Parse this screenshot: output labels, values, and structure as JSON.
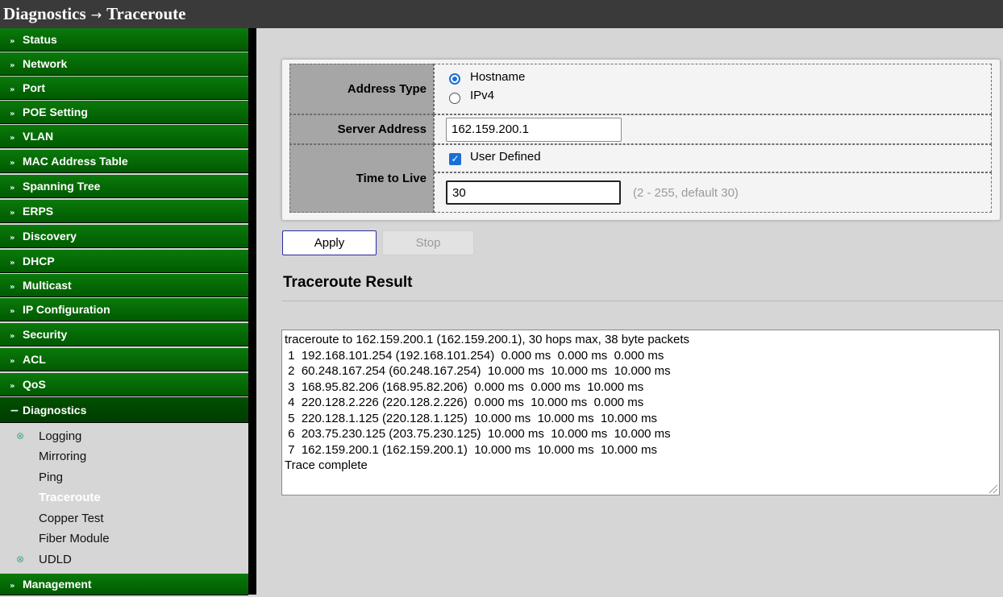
{
  "titlebar": {
    "section": "Diagnostics",
    "separator": "→",
    "page": "Traceroute"
  },
  "menu": [
    {
      "label": "Status",
      "icon": "double-chevron-down-icon"
    },
    {
      "label": "Network",
      "icon": "double-chevron-down-icon"
    },
    {
      "label": "Port",
      "icon": "double-chevron-down-icon"
    },
    {
      "label": "POE Setting",
      "icon": "double-chevron-down-icon"
    },
    {
      "label": "VLAN",
      "icon": "double-chevron-down-icon"
    },
    {
      "label": "MAC Address Table",
      "icon": "double-chevron-down-icon"
    },
    {
      "label": "Spanning Tree",
      "icon": "double-chevron-down-icon"
    },
    {
      "label": "ERPS",
      "icon": "double-chevron-down-icon"
    },
    {
      "label": "Discovery",
      "icon": "double-chevron-down-icon"
    },
    {
      "label": "DHCP",
      "icon": "double-chevron-down-icon"
    },
    {
      "label": "Multicast",
      "icon": "double-chevron-down-icon"
    },
    {
      "label": "IP Configuration",
      "icon": "double-chevron-down-icon"
    },
    {
      "label": "Security",
      "icon": "double-chevron-down-icon"
    },
    {
      "label": "ACL",
      "icon": "double-chevron-down-icon"
    },
    {
      "label": "QoS",
      "icon": "double-chevron-down-icon"
    },
    {
      "label": "Diagnostics",
      "icon": "minus-icon"
    },
    {
      "label": "Management",
      "icon": "double-chevron-down-icon"
    }
  ],
  "submenu": [
    {
      "label": "Logging",
      "icon": "expand-icon"
    },
    {
      "label": "Mirroring"
    },
    {
      "label": "Ping"
    },
    {
      "label": "Traceroute",
      "active": true
    },
    {
      "label": "Copper Test"
    },
    {
      "label": "Fiber Module"
    },
    {
      "label": "UDLD",
      "icon": "expand-icon"
    }
  ],
  "form": {
    "address_type": {
      "label": "Address Type",
      "options": [
        "Hostname",
        "IPv4"
      ],
      "selected": "Hostname"
    },
    "server_address": {
      "label": "Server Address",
      "value": "162.159.200.1"
    },
    "time_to_live": {
      "label": "Time to Live",
      "user_defined_label": "User Defined",
      "user_defined_checked": true,
      "value": "30",
      "hint": "(2 - 255, default 30)"
    }
  },
  "buttons": {
    "apply": "Apply",
    "stop": "Stop"
  },
  "result": {
    "title": "Traceroute Result",
    "lines": [
      "traceroute to 162.159.200.1 (162.159.200.1), 30 hops max, 38 byte packets",
      " 1  192.168.101.254 (192.168.101.254)  0.000 ms  0.000 ms  0.000 ms",
      " 2  60.248.167.254 (60.248.167.254)  10.000 ms  10.000 ms  10.000 ms",
      " 3  168.95.82.206 (168.95.82.206)  0.000 ms  0.000 ms  10.000 ms",
      " 4  220.128.2.226 (220.128.2.226)  0.000 ms  10.000 ms  0.000 ms",
      " 5  220.128.1.125 (220.128.1.125)  10.000 ms  10.000 ms  10.000 ms",
      " 6  203.75.230.125 (203.75.230.125)  10.000 ms  10.000 ms  10.000 ms",
      " 7  162.159.200.1 (162.159.200.1)  10.000 ms  10.000 ms  10.000 ms",
      "Trace complete"
    ]
  },
  "colors": {
    "menu_green": "#0b7a0b",
    "titlebar": "#3a3a3a",
    "accent_blue": "#1a6fd6",
    "label_gray": "#a6a6a6"
  }
}
